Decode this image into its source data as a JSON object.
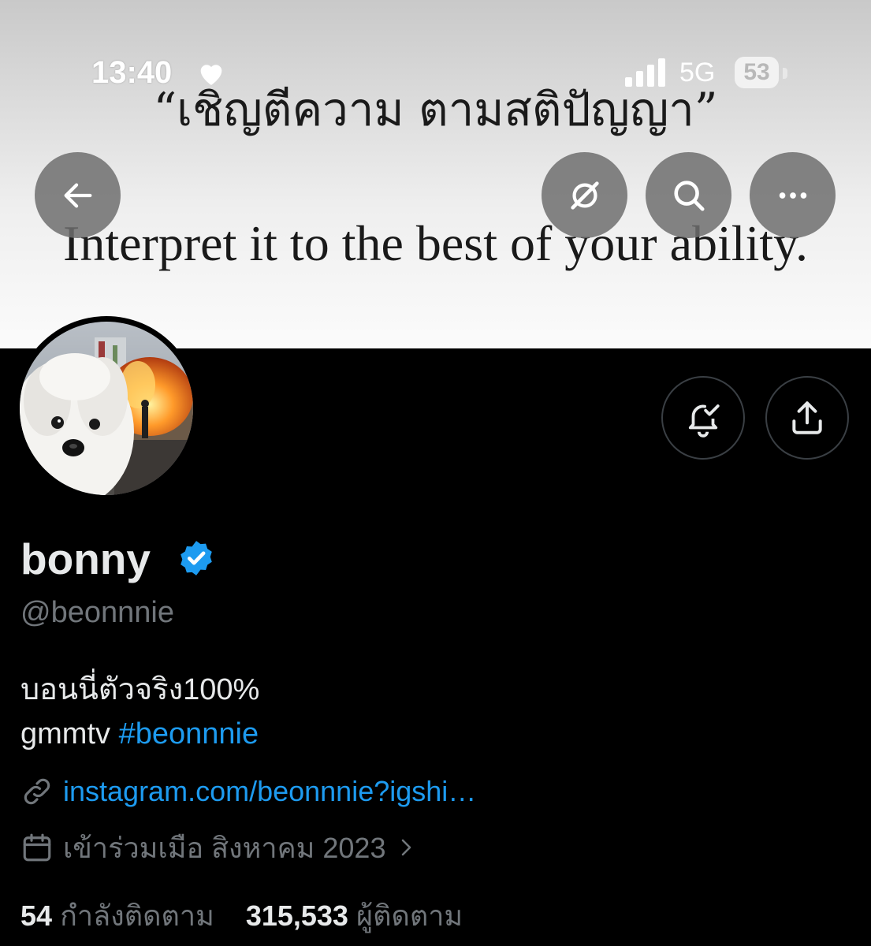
{
  "banner": {
    "thai_quote": "“เชิญตีความ ตามสติปัญญา”",
    "english_quote": "Interpret it to the best of your ability."
  },
  "status_bar": {
    "time": "13:40",
    "network": "5G",
    "battery": "53"
  },
  "header_actions": {
    "back_icon": "arrow-left-icon",
    "grok_icon": "grok-icon",
    "search_icon": "search-icon",
    "more_icon": "more-icon"
  },
  "profile": {
    "display_name": "bonny",
    "verified": true,
    "handle": "@beonnnie",
    "bio_line1": "บอนนี่ตัวจริง100%",
    "bio_line2_prefix": "gmmtv ",
    "bio_hashtag": "#beonnnie",
    "link": "instagram.com/beonnnie?igshi…",
    "joined": "เข้าร่วมเมือ สิงหาคม 2023",
    "following_count": "54",
    "following_label": "กำลังติดตาม",
    "followers_count": "315,533",
    "followers_label": "ผู้ติดตาม"
  },
  "colors": {
    "accent": "#1d9bf0",
    "muted": "#71767b",
    "background": "#000000",
    "text": "#e7e9ea"
  }
}
